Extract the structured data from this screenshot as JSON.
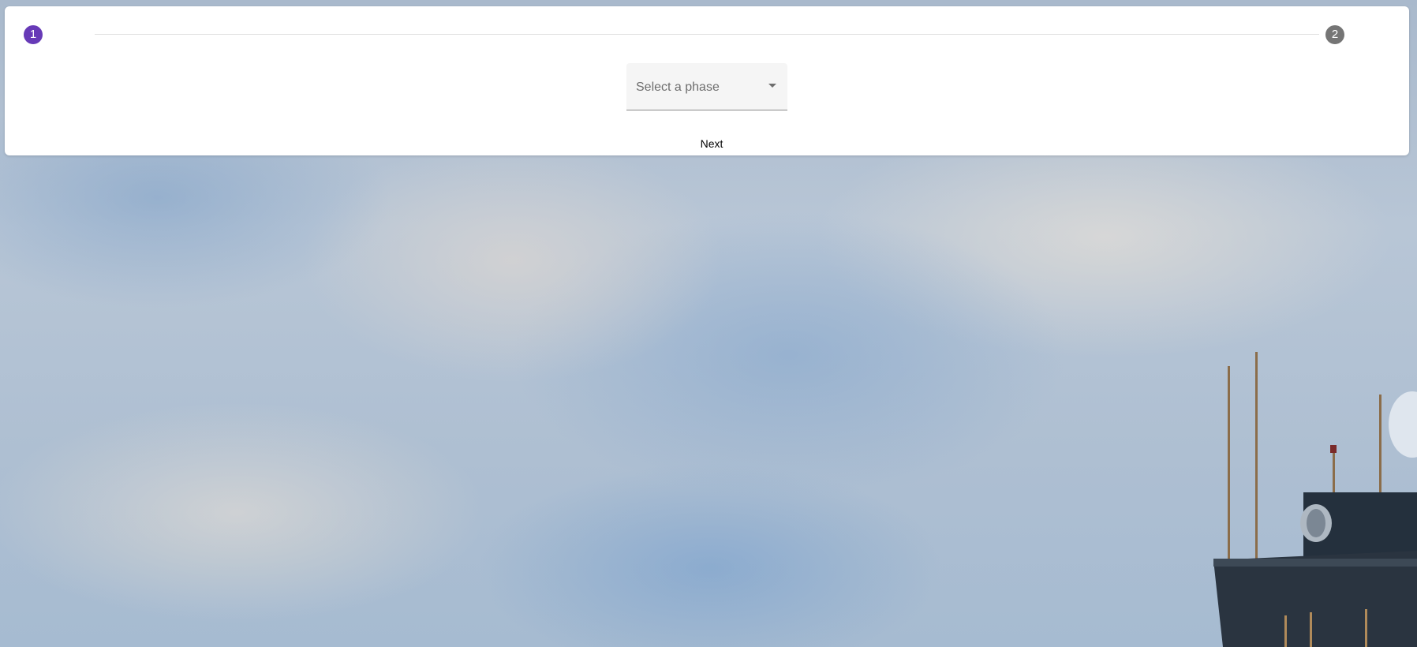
{
  "stepper": {
    "steps": [
      {
        "number": "1",
        "state": "active",
        "color": "#673ab7"
      },
      {
        "number": "2",
        "state": "inactive",
        "color": "#757575"
      }
    ]
  },
  "phase_select": {
    "placeholder": "Select a phase"
  },
  "actions": {
    "next_label": "Next"
  },
  "theme": {
    "accent": "#673ab7",
    "card_background": "#ffffff"
  }
}
